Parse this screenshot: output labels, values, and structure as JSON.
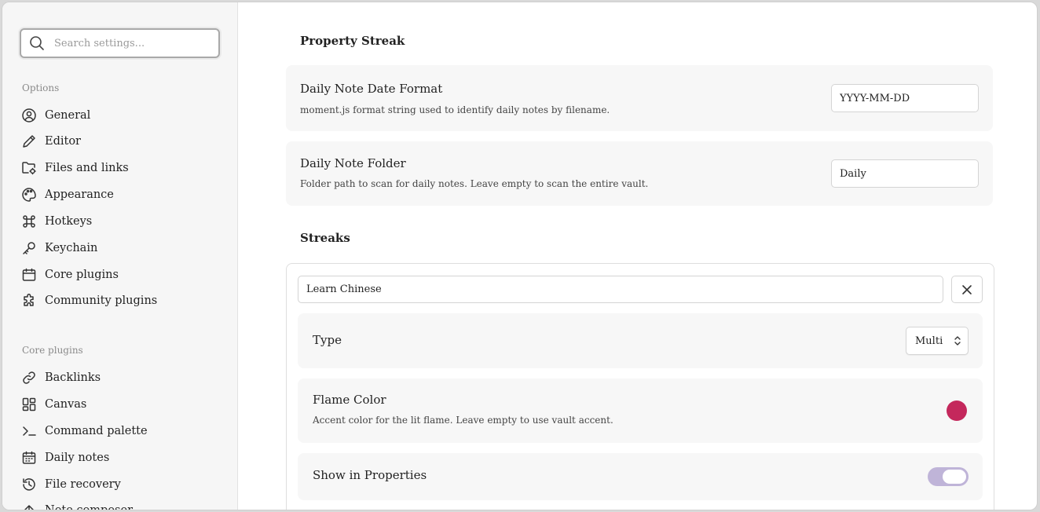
{
  "sidebar": {
    "search": {
      "placeholder": "Search settings...",
      "value": ""
    },
    "options_label": "Options",
    "options": [
      {
        "label": "General",
        "icon": "gear-circle-icon"
      },
      {
        "label": "Editor",
        "icon": "pencil-icon"
      },
      {
        "label": "Files and links",
        "icon": "folder-cog-icon"
      },
      {
        "label": "Appearance",
        "icon": "palette-icon"
      },
      {
        "label": "Hotkeys",
        "icon": "command-icon"
      },
      {
        "label": "Keychain",
        "icon": "key-icon"
      },
      {
        "label": "Core plugins",
        "icon": "calendar-box-icon"
      },
      {
        "label": "Community plugins",
        "icon": "puzzle-icon"
      }
    ],
    "core_label": "Core plugins",
    "core": [
      {
        "label": "Backlinks",
        "icon": "backlink-icon"
      },
      {
        "label": "Canvas",
        "icon": "canvas-grid-icon"
      },
      {
        "label": "Command palette",
        "icon": "terminal-icon"
      },
      {
        "label": "Daily notes",
        "icon": "calendar-icon"
      },
      {
        "label": "File recovery",
        "icon": "history-icon"
      },
      {
        "label": "Note composer",
        "icon": "arrow-up-icon"
      }
    ]
  },
  "main": {
    "section1_title": "Property Streak",
    "date_format": {
      "name": "Daily Note Date Format",
      "desc": "moment.js format string used to identify daily notes by filename.",
      "value": "YYYY-MM-DD"
    },
    "folder": {
      "name": "Daily Note Folder",
      "desc": "Folder path to scan for daily notes. Leave empty to scan the entire vault.",
      "value": "Daily"
    },
    "section2_title": "Streaks",
    "streak": {
      "name_value": "Learn Chinese",
      "type_label": "Type",
      "type_value": "Multi",
      "flame_label": "Flame Color",
      "flame_desc": "Accent color for the lit flame. Leave empty to use vault accent.",
      "flame_color": "#c4285c",
      "show_label": "Show in Properties",
      "show_enabled": true
    }
  }
}
